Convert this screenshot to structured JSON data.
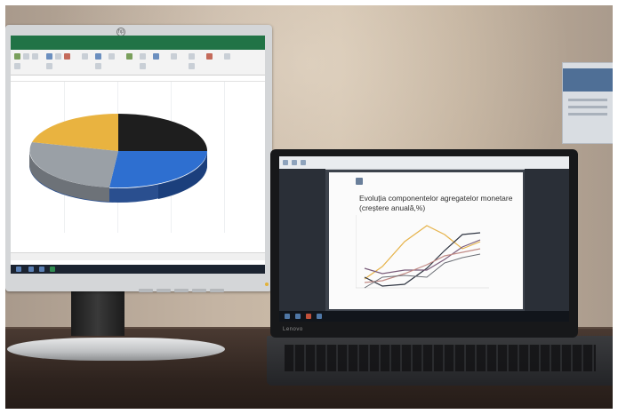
{
  "photo": {
    "subject": "",
    "monitor": {
      "brand_mark": "hp",
      "app": "Excel",
      "chart": {
        "type": "pie",
        "slices": [
          {
            "color": "#1e1e1e",
            "value": 28
          },
          {
            "color": "#2e6fd0",
            "value": 24
          },
          {
            "color": "#9aa0a6",
            "value": 20
          },
          {
            "color": "#e9b340",
            "value": 28
          }
        ]
      }
    },
    "laptop": {
      "brand": "Lenovo",
      "slide_title": "Evoluția componentelor agregatelor monetare (creștere anuală,%)",
      "chart": {
        "type": "line",
        "series_colors": [
          "#e6b34a",
          "#2f3542",
          "#7a5c7a",
          "#c28b86",
          "#6c6f76"
        ]
      }
    }
  }
}
